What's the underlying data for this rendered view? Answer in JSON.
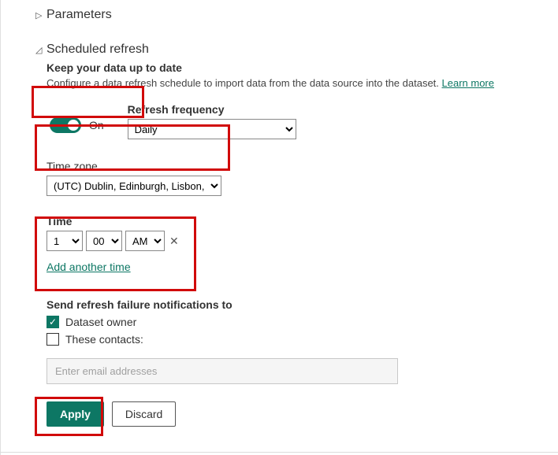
{
  "sections": {
    "parameters_label": "Parameters",
    "scheduled_refresh_label": "Scheduled refresh"
  },
  "scheduled": {
    "keep_data_title": "Keep your data up to date",
    "desc": "Configure a data refresh schedule to import data from the data source into the dataset. ",
    "learn_more": "Learn more",
    "toggle_on_label": "On",
    "freq_label": "Refresh frequency",
    "freq_value": "Daily",
    "tz_label": "Time zone",
    "tz_value": "(UTC) Dublin, Edinburgh, Lisbon, London",
    "time_label": "Time",
    "time_hour": "1",
    "time_min": "00",
    "time_ampm": "AM",
    "add_another_time": "Add another time",
    "notif_title": "Send refresh failure notifications to",
    "notif_owner_label": "Dataset owner",
    "notif_owner_checked": true,
    "notif_contacts_label": "These contacts:",
    "notif_contacts_checked": false,
    "contacts_placeholder": "Enter email addresses"
  },
  "buttons": {
    "apply": "Apply",
    "discard": "Discard"
  }
}
